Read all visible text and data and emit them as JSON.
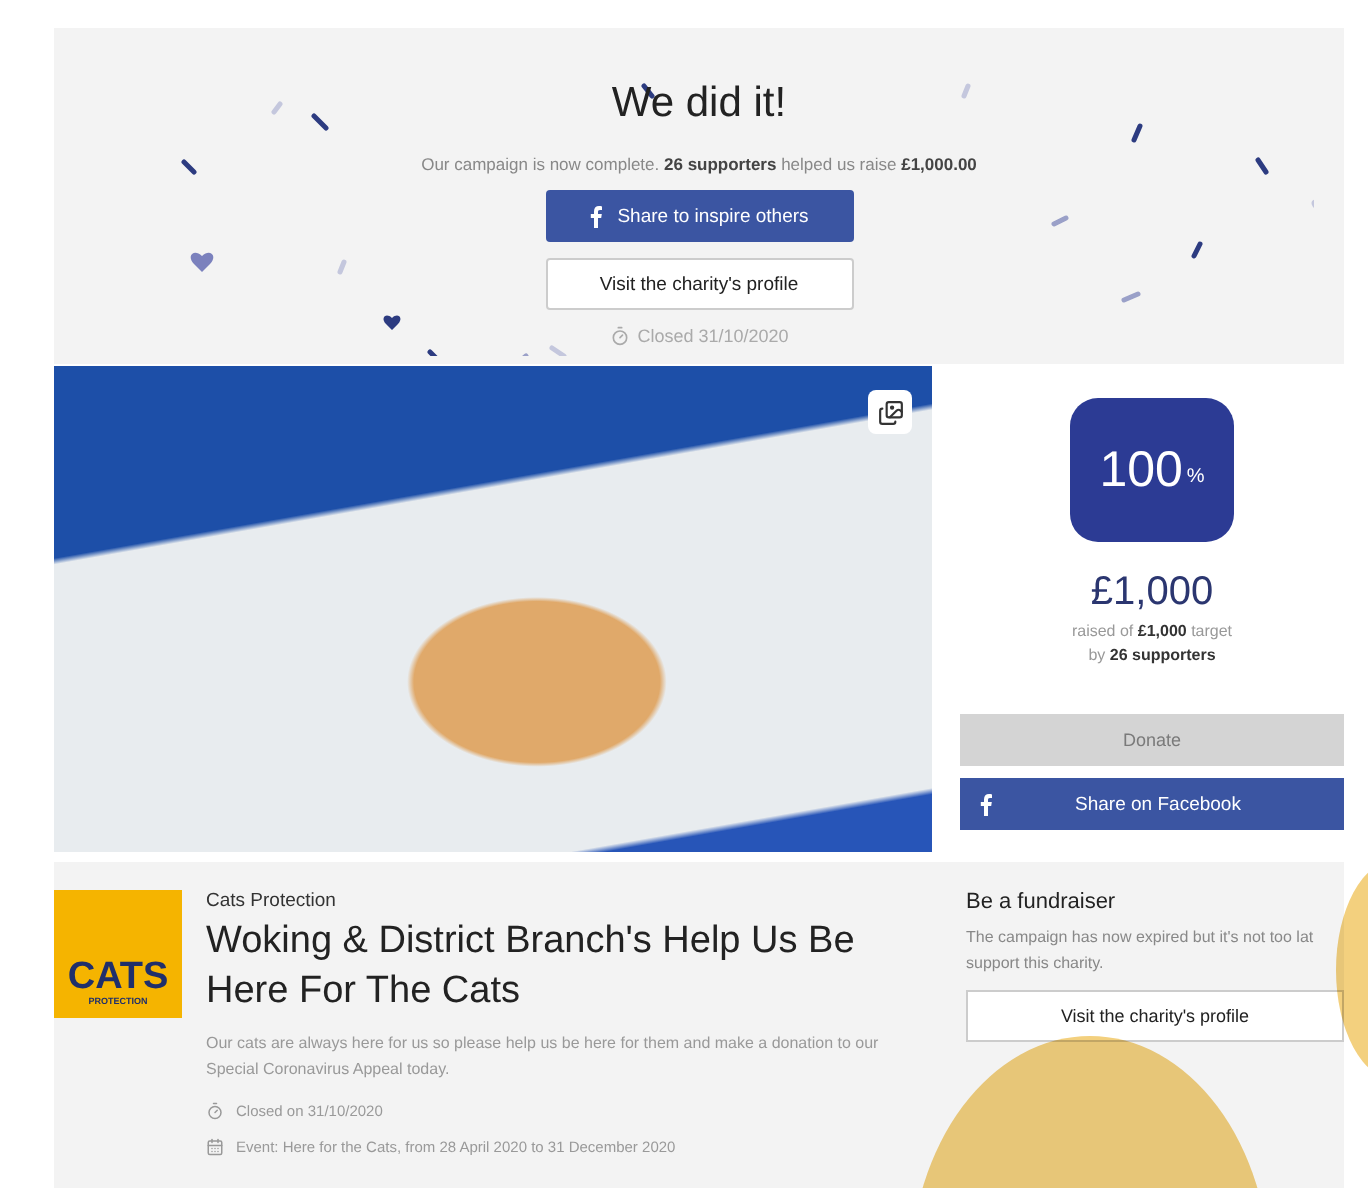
{
  "banner": {
    "title": "We did it!",
    "message": "Our campaign is now complete. **26 supporters** helped us raise **£1,000.00**",
    "share_button": "Share to inspire others",
    "profile_button": "Visit the charity's profile",
    "closed": "Closed 31/10/2020"
  },
  "progress": {
    "percent": "100",
    "percent_sign": "%",
    "amount": "£1,000",
    "target": "raised of **£1,000** target",
    "supporters": "by **26 supporters**",
    "donate_button": {
      "label": "Donate",
      "disabled": true
    },
    "facebook_button": "Share on Facebook"
  },
  "campaign": {
    "logo": {
      "word": "CATS",
      "tagline": "PROTECTION"
    },
    "charity": "Cats Protection",
    "title": "Woking & District Branch's Help Us Be Here For The Cats",
    "description": "Our cats are always here for us so please help us be here for them and make a donation to our Special Coronavirus Appeal today.",
    "details": [
      {
        "kind": "closed",
        "text": "Closed on 31/10/2020"
      },
      {
        "kind": "event",
        "text": "Event: Here for the Cats, from 28 April 2020 to 31 December 2020"
      }
    ]
  },
  "fundraiser": {
    "title": "Be a fundraiser",
    "text": "The campaign has now expired but it's not too lat",
    "text_2": "support this charity.",
    "button": "Visit the charity's profile"
  }
}
